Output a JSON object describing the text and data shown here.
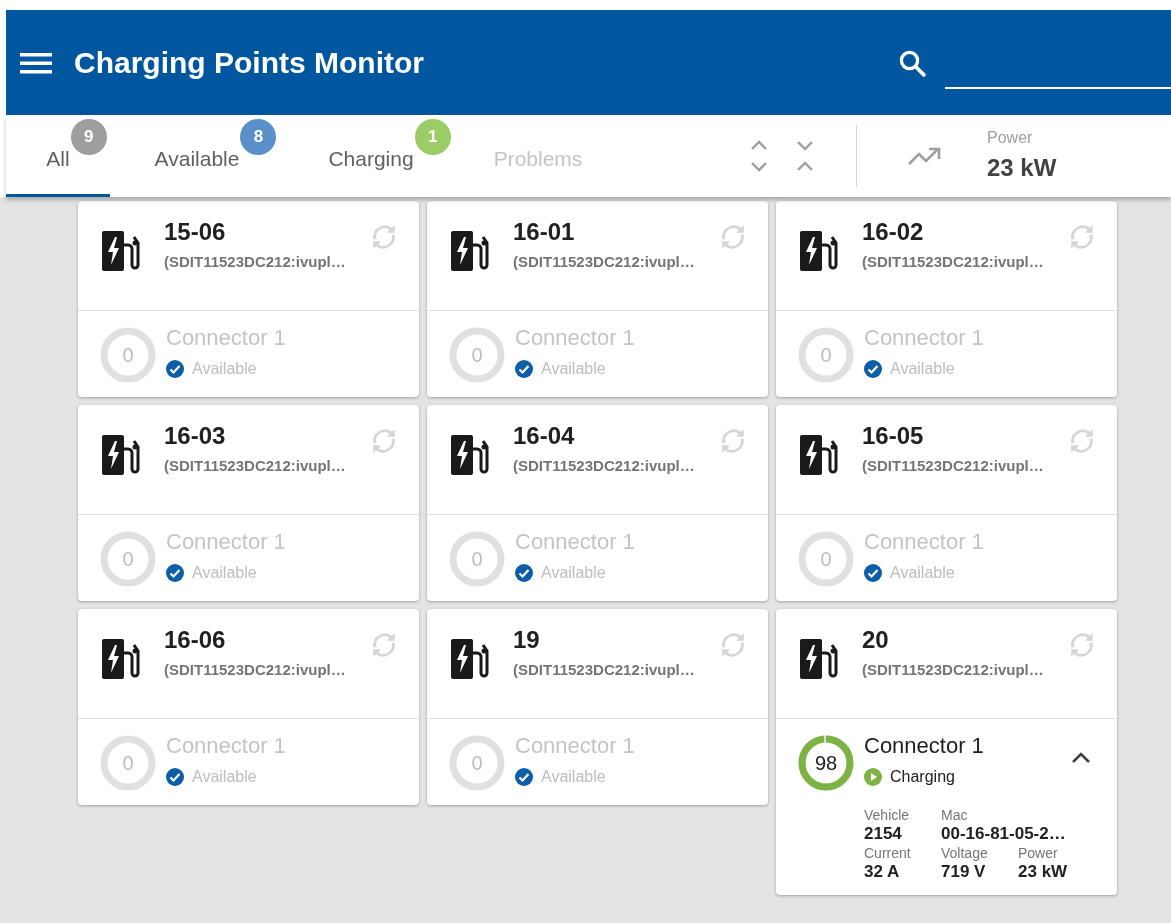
{
  "app_bar": {
    "title": "Charging Points Monitor"
  },
  "tabs": [
    {
      "label": "All",
      "badge": "9",
      "color": "#9e9e9e",
      "selected": true,
      "disabled": false
    },
    {
      "label": "Available",
      "badge": "8",
      "color": "#5b8fc7",
      "selected": false,
      "disabled": false
    },
    {
      "label": "Charging",
      "badge": "1",
      "color": "#9ccc65",
      "selected": false,
      "disabled": false
    },
    {
      "label": "Problems",
      "selected": false,
      "disabled": true
    }
  ],
  "power": {
    "label": "Power",
    "value": "23 kW"
  },
  "stations": [
    {
      "name": "15-06",
      "id": "(SDIT11523DC212:ivupl…",
      "connector": {
        "name": "Connector 1",
        "reading": "0",
        "status": "Available",
        "kind": "available",
        "expanded": false
      }
    },
    {
      "name": "16-01",
      "id": "(SDIT11523DC212:ivupl…",
      "connector": {
        "name": "Connector 1",
        "reading": "0",
        "status": "Available",
        "kind": "available",
        "expanded": false
      }
    },
    {
      "name": "16-02",
      "id": "(SDIT11523DC212:ivupl…",
      "connector": {
        "name": "Connector 1",
        "reading": "0",
        "status": "Available",
        "kind": "available",
        "expanded": false
      }
    },
    {
      "name": "16-03",
      "id": "(SDIT11523DC212:ivupl…",
      "connector": {
        "name": "Connector 1",
        "reading": "0",
        "status": "Available",
        "kind": "available",
        "expanded": false
      }
    },
    {
      "name": "16-04",
      "id": "(SDIT11523DC212:ivupl…",
      "connector": {
        "name": "Connector 1",
        "reading": "0",
        "status": "Available",
        "kind": "available",
        "expanded": false
      }
    },
    {
      "name": "16-05",
      "id": "(SDIT11523DC212:ivupl…",
      "connector": {
        "name": "Connector 1",
        "reading": "0",
        "status": "Available",
        "kind": "available",
        "expanded": false
      }
    },
    {
      "name": "16-06",
      "id": "(SDIT11523DC212:ivupl…",
      "connector": {
        "name": "Connector 1",
        "reading": "0",
        "status": "Available",
        "kind": "available",
        "expanded": false
      }
    },
    {
      "name": "19",
      "id": "(SDIT11523DC212:ivupl…",
      "connector": {
        "name": "Connector 1",
        "reading": "0",
        "status": "Available",
        "kind": "available",
        "expanded": false
      }
    },
    {
      "name": "20",
      "id": "(SDIT11523DC212:ivupl…",
      "connector": {
        "name": "Connector 1",
        "reading": "98",
        "status": "Charging",
        "kind": "charging",
        "expanded": true,
        "details": [
          [
            {
              "label": "Vehicle",
              "value": "2154"
            },
            {
              "label": "Mac",
              "value": "00-16-81-05-2…"
            }
          ],
          [
            {
              "label": "Current",
              "value": "32 A"
            },
            {
              "label": "Voltage",
              "value": "719 V"
            },
            {
              "label": "Power",
              "value": "23 kW"
            }
          ]
        ]
      }
    }
  ]
}
